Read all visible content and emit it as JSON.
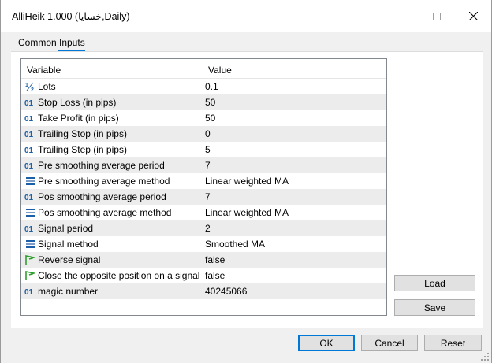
{
  "window": {
    "title": "AlliHeik 1.000 (خسايا,Daily)",
    "min_icon": "minimize-icon",
    "max_icon": "maximize-icon",
    "close_icon": "close-icon"
  },
  "tabs": [
    {
      "label": "Common",
      "selected": false
    },
    {
      "label": "Inputs",
      "selected": true
    }
  ],
  "grid": {
    "headers": [
      "Variable",
      "Value"
    ],
    "rows": [
      {
        "icon": "fraction-icon",
        "name": "Lots",
        "value": "0.1"
      },
      {
        "icon": "integer-icon",
        "name": "Stop Loss (in pips)",
        "value": "50"
      },
      {
        "icon": "integer-icon",
        "name": "Take Profit (in pips)",
        "value": "50"
      },
      {
        "icon": "integer-icon",
        "name": "Trailing Stop (in pips)",
        "value": "0"
      },
      {
        "icon": "integer-icon",
        "name": "Trailing Step (in pips)",
        "value": "5"
      },
      {
        "icon": "integer-icon",
        "name": "Pre smoothing average period",
        "value": "7"
      },
      {
        "icon": "enum-icon",
        "name": "Pre smoothing average method",
        "value": "Linear weighted MA"
      },
      {
        "icon": "integer-icon",
        "name": "Pos smoothing average period",
        "value": "7"
      },
      {
        "icon": "enum-icon",
        "name": "Pos smoothing average method",
        "value": "Linear weighted MA"
      },
      {
        "icon": "integer-icon",
        "name": "Signal period",
        "value": "2"
      },
      {
        "icon": "enum-icon",
        "name": "Signal method",
        "value": "Smoothed MA"
      },
      {
        "icon": "bool-icon",
        "name": "Reverse signal",
        "value": "false"
      },
      {
        "icon": "bool-icon",
        "name": "Close the opposite position on a signal",
        "value": "false"
      },
      {
        "icon": "integer-icon",
        "name": "magic number",
        "value": "40245066"
      }
    ]
  },
  "buttons": {
    "load": "Load",
    "save": "Save",
    "ok": "OK",
    "cancel": "Cancel",
    "reset": "Reset"
  },
  "colors": {
    "accent": "#0078d7",
    "int_icon": "#1b5fa8",
    "bool_icon": "#2e9e2e"
  }
}
